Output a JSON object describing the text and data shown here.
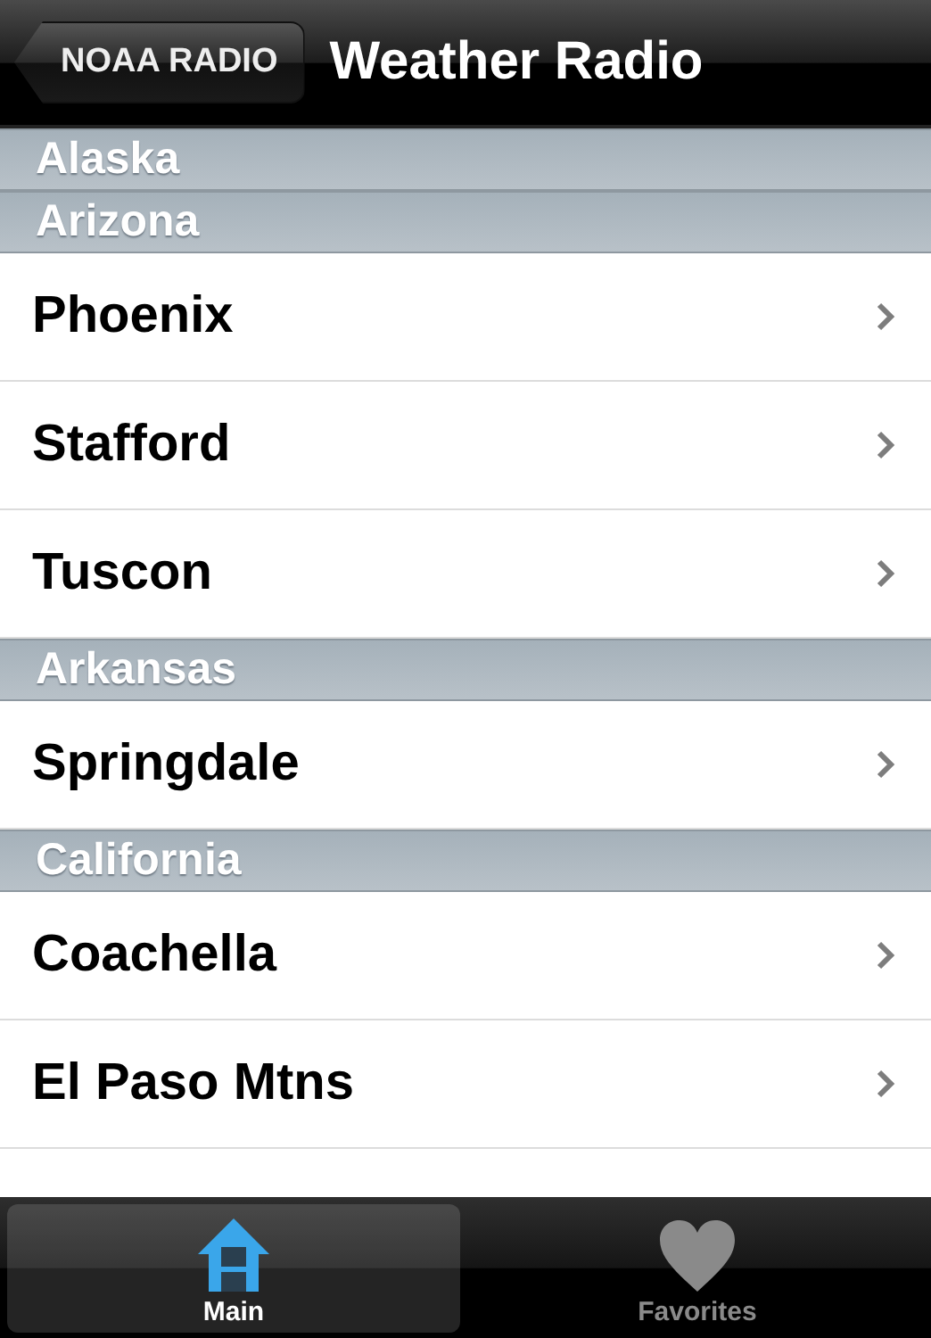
{
  "nav_bar": {
    "back_button": "NOAA RADIO",
    "title": "Weather Radio"
  },
  "sections": [
    {
      "title": "Alaska"
    },
    {
      "title": "Arizona",
      "rows": [
        {
          "label": "Phoenix"
        },
        {
          "label": "Stafford"
        },
        {
          "label": "Tuscon"
        }
      ]
    },
    {
      "title": "Arkansas",
      "rows": [
        {
          "label": "Springdale"
        }
      ]
    },
    {
      "title": "California",
      "rows": [
        {
          "label": "Coachella"
        },
        {
          "label": "El Paso Mtns"
        }
      ]
    }
  ],
  "tab_bar": [
    {
      "label": "Main",
      "kind": "house",
      "selected": true
    },
    {
      "label": "Favorites",
      "kind": "heart",
      "selected": false
    }
  ]
}
